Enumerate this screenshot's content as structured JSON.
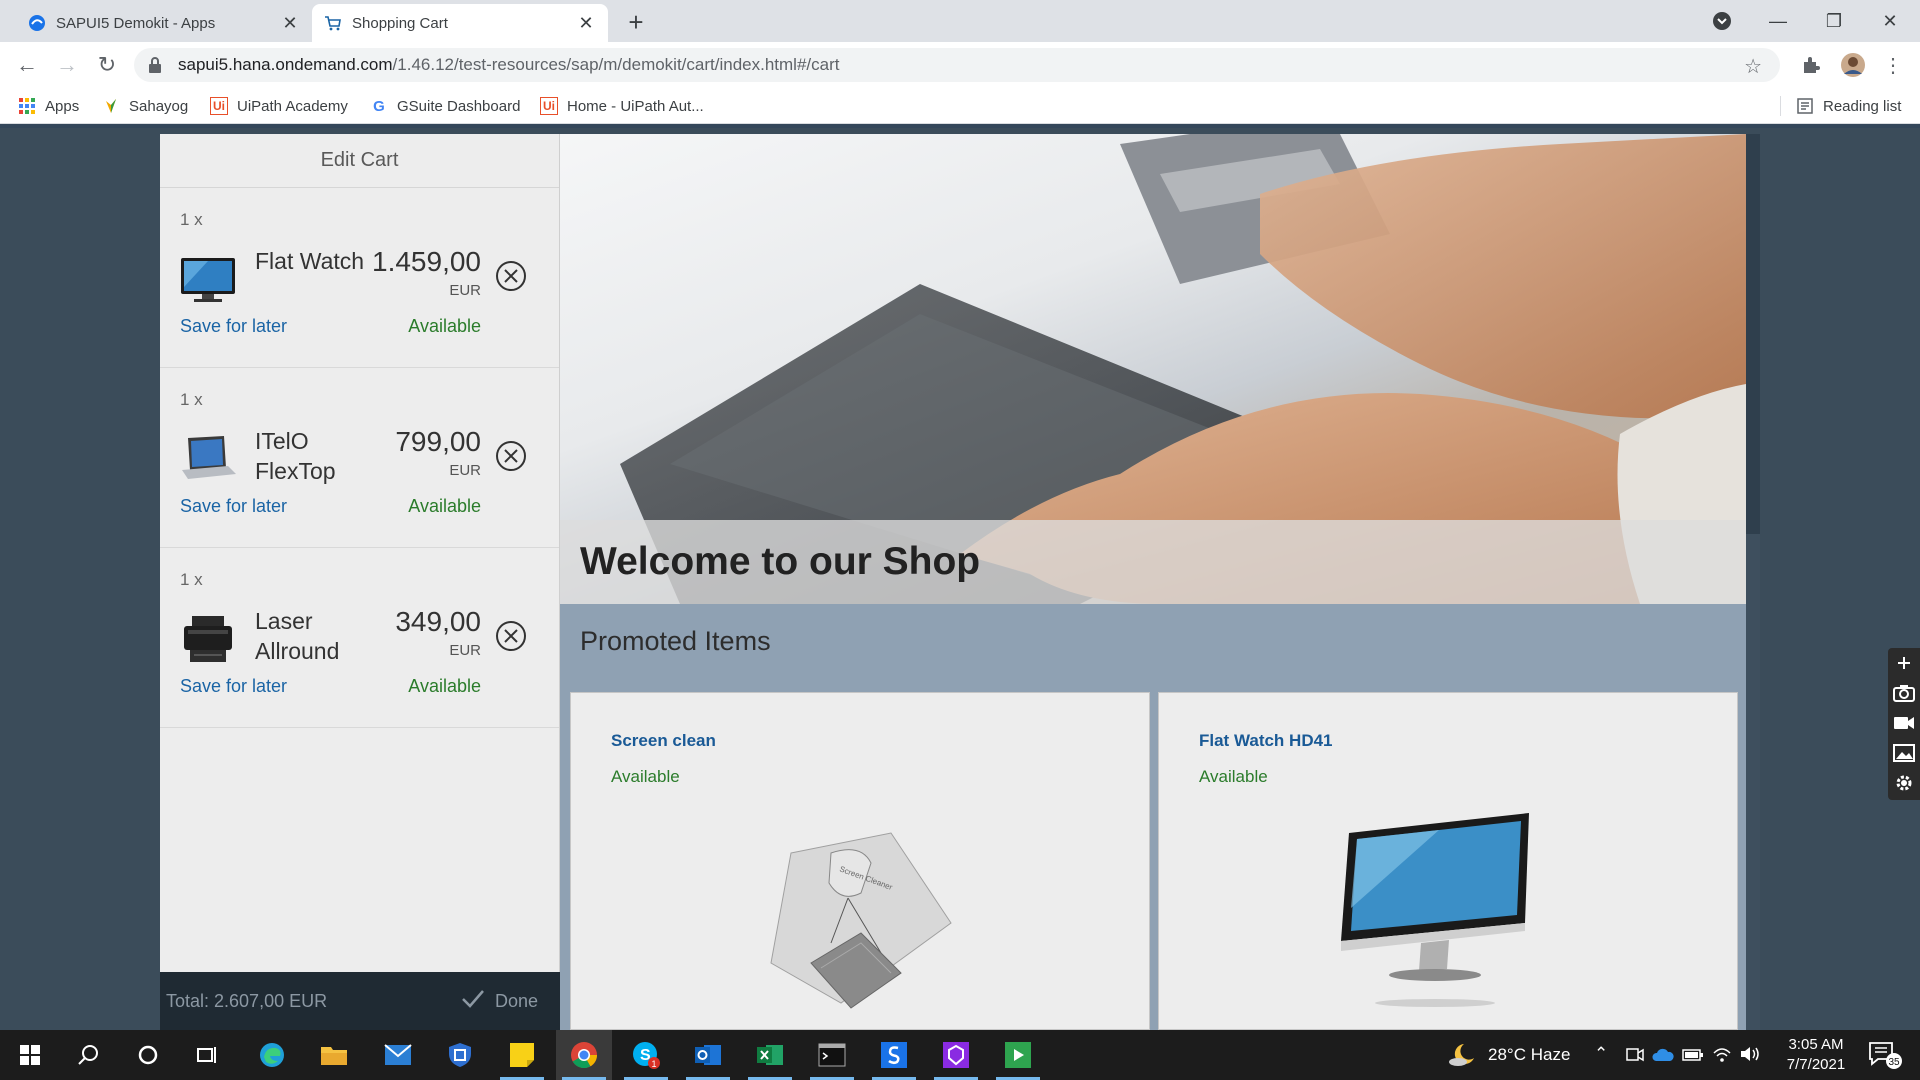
{
  "browser": {
    "tabs": [
      {
        "title": "SAPUI5 Demokit - Apps",
        "active": false
      },
      {
        "title": "Shopping Cart",
        "active": true
      }
    ],
    "url_host": "sapui5.hana.ondemand.com",
    "url_path": "/1.46.12/test-resources/sap/m/demokit/cart/index.html#/cart",
    "bookmarks": [
      {
        "label": "Apps",
        "icon": "apps-grid-icon"
      },
      {
        "label": "Sahayog",
        "icon": "sahayog-icon"
      },
      {
        "label": "UiPath Academy",
        "icon": "uipath-icon"
      },
      {
        "label": "GSuite Dashboard",
        "icon": "google-icon"
      },
      {
        "label": "Home - UiPath Aut...",
        "icon": "uipath-icon"
      }
    ],
    "reading_list": "Reading list"
  },
  "cart": {
    "header": "Edit Cart",
    "items": [
      {
        "qty": "1 x",
        "name": "Flat Watch",
        "price": "1.459,00",
        "currency": "EUR",
        "save_label": "Save for later",
        "status": "Available",
        "image": "monitor-image"
      },
      {
        "qty": "1 x",
        "name": "ITelO FlexTop",
        "price": "799,00",
        "currency": "EUR",
        "save_label": "Save for later",
        "status": "Available",
        "image": "laptop-image"
      },
      {
        "qty": "1 x",
        "name": "Laser Allround",
        "price": "349,00",
        "currency": "EUR",
        "save_label": "Save for later",
        "status": "Available",
        "image": "printer-image"
      }
    ],
    "total": "Total: 2.607,00 EUR",
    "done_label": "Done"
  },
  "shop": {
    "welcome": "Welcome to our Shop",
    "promoted_title": "Promoted Items",
    "promoted": [
      {
        "name": "Screen clean",
        "status": "Available",
        "image": "screen-cleaner-image",
        "image_text": "Screen Cleaner"
      },
      {
        "name": "Flat Watch HD41",
        "status": "Available",
        "image": "monitor-image"
      }
    ]
  },
  "taskbar": {
    "weather": "28°C  Haze",
    "time": "3:05 AM",
    "date": "7/7/2021",
    "notifications": "35",
    "skype_badge": "1"
  },
  "colors": {
    "link": "#1a64a5",
    "available": "#2b7c2b",
    "footer": "#1f2a33",
    "page_bg": "#3b4c5a"
  }
}
